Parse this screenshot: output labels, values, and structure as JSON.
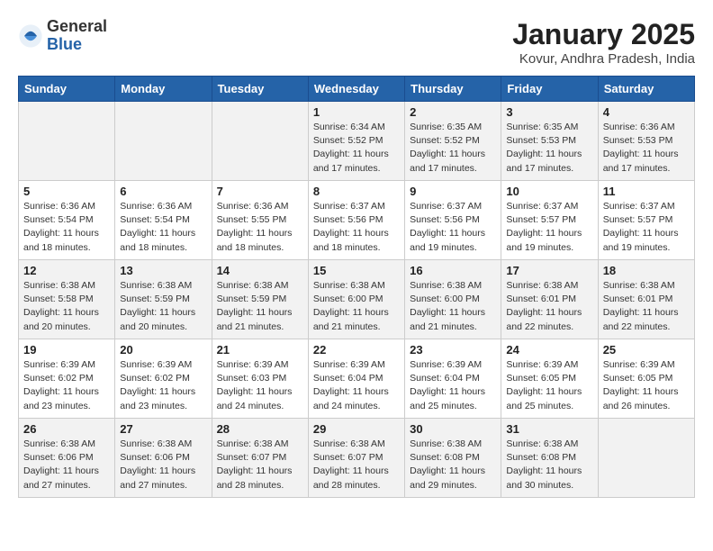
{
  "header": {
    "logo_general": "General",
    "logo_blue": "Blue",
    "month_year": "January 2025",
    "location": "Kovur, Andhra Pradesh, India"
  },
  "weekdays": [
    "Sunday",
    "Monday",
    "Tuesday",
    "Wednesday",
    "Thursday",
    "Friday",
    "Saturday"
  ],
  "weeks": [
    [
      {
        "day": "",
        "info": ""
      },
      {
        "day": "",
        "info": ""
      },
      {
        "day": "",
        "info": ""
      },
      {
        "day": "1",
        "info": "Sunrise: 6:34 AM\nSunset: 5:52 PM\nDaylight: 11 hours\nand 17 minutes."
      },
      {
        "day": "2",
        "info": "Sunrise: 6:35 AM\nSunset: 5:52 PM\nDaylight: 11 hours\nand 17 minutes."
      },
      {
        "day": "3",
        "info": "Sunrise: 6:35 AM\nSunset: 5:53 PM\nDaylight: 11 hours\nand 17 minutes."
      },
      {
        "day": "4",
        "info": "Sunrise: 6:36 AM\nSunset: 5:53 PM\nDaylight: 11 hours\nand 17 minutes."
      }
    ],
    [
      {
        "day": "5",
        "info": "Sunrise: 6:36 AM\nSunset: 5:54 PM\nDaylight: 11 hours\nand 18 minutes."
      },
      {
        "day": "6",
        "info": "Sunrise: 6:36 AM\nSunset: 5:54 PM\nDaylight: 11 hours\nand 18 minutes."
      },
      {
        "day": "7",
        "info": "Sunrise: 6:36 AM\nSunset: 5:55 PM\nDaylight: 11 hours\nand 18 minutes."
      },
      {
        "day": "8",
        "info": "Sunrise: 6:37 AM\nSunset: 5:56 PM\nDaylight: 11 hours\nand 18 minutes."
      },
      {
        "day": "9",
        "info": "Sunrise: 6:37 AM\nSunset: 5:56 PM\nDaylight: 11 hours\nand 19 minutes."
      },
      {
        "day": "10",
        "info": "Sunrise: 6:37 AM\nSunset: 5:57 PM\nDaylight: 11 hours\nand 19 minutes."
      },
      {
        "day": "11",
        "info": "Sunrise: 6:37 AM\nSunset: 5:57 PM\nDaylight: 11 hours\nand 19 minutes."
      }
    ],
    [
      {
        "day": "12",
        "info": "Sunrise: 6:38 AM\nSunset: 5:58 PM\nDaylight: 11 hours\nand 20 minutes."
      },
      {
        "day": "13",
        "info": "Sunrise: 6:38 AM\nSunset: 5:59 PM\nDaylight: 11 hours\nand 20 minutes."
      },
      {
        "day": "14",
        "info": "Sunrise: 6:38 AM\nSunset: 5:59 PM\nDaylight: 11 hours\nand 21 minutes."
      },
      {
        "day": "15",
        "info": "Sunrise: 6:38 AM\nSunset: 6:00 PM\nDaylight: 11 hours\nand 21 minutes."
      },
      {
        "day": "16",
        "info": "Sunrise: 6:38 AM\nSunset: 6:00 PM\nDaylight: 11 hours\nand 21 minutes."
      },
      {
        "day": "17",
        "info": "Sunrise: 6:38 AM\nSunset: 6:01 PM\nDaylight: 11 hours\nand 22 minutes."
      },
      {
        "day": "18",
        "info": "Sunrise: 6:38 AM\nSunset: 6:01 PM\nDaylight: 11 hours\nand 22 minutes."
      }
    ],
    [
      {
        "day": "19",
        "info": "Sunrise: 6:39 AM\nSunset: 6:02 PM\nDaylight: 11 hours\nand 23 minutes."
      },
      {
        "day": "20",
        "info": "Sunrise: 6:39 AM\nSunset: 6:02 PM\nDaylight: 11 hours\nand 23 minutes."
      },
      {
        "day": "21",
        "info": "Sunrise: 6:39 AM\nSunset: 6:03 PM\nDaylight: 11 hours\nand 24 minutes."
      },
      {
        "day": "22",
        "info": "Sunrise: 6:39 AM\nSunset: 6:04 PM\nDaylight: 11 hours\nand 24 minutes."
      },
      {
        "day": "23",
        "info": "Sunrise: 6:39 AM\nSunset: 6:04 PM\nDaylight: 11 hours\nand 25 minutes."
      },
      {
        "day": "24",
        "info": "Sunrise: 6:39 AM\nSunset: 6:05 PM\nDaylight: 11 hours\nand 25 minutes."
      },
      {
        "day": "25",
        "info": "Sunrise: 6:39 AM\nSunset: 6:05 PM\nDaylight: 11 hours\nand 26 minutes."
      }
    ],
    [
      {
        "day": "26",
        "info": "Sunrise: 6:38 AM\nSunset: 6:06 PM\nDaylight: 11 hours\nand 27 minutes."
      },
      {
        "day": "27",
        "info": "Sunrise: 6:38 AM\nSunset: 6:06 PM\nDaylight: 11 hours\nand 27 minutes."
      },
      {
        "day": "28",
        "info": "Sunrise: 6:38 AM\nSunset: 6:07 PM\nDaylight: 11 hours\nand 28 minutes."
      },
      {
        "day": "29",
        "info": "Sunrise: 6:38 AM\nSunset: 6:07 PM\nDaylight: 11 hours\nand 28 minutes."
      },
      {
        "day": "30",
        "info": "Sunrise: 6:38 AM\nSunset: 6:08 PM\nDaylight: 11 hours\nand 29 minutes."
      },
      {
        "day": "31",
        "info": "Sunrise: 6:38 AM\nSunset: 6:08 PM\nDaylight: 11 hours\nand 30 minutes."
      },
      {
        "day": "",
        "info": ""
      }
    ]
  ]
}
